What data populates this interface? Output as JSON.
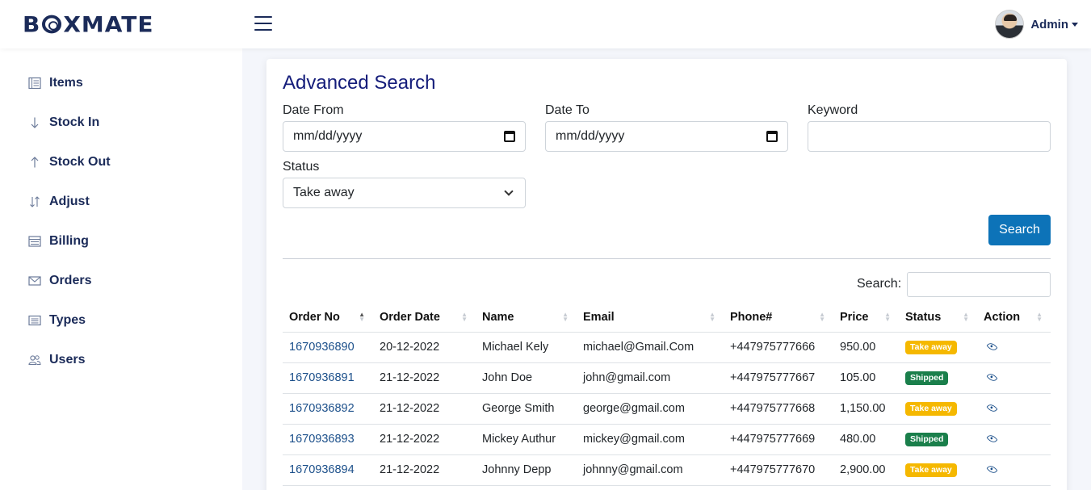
{
  "header": {
    "logo_text": "BOXMATE",
    "user_name": "Admin"
  },
  "sidebar": {
    "items": [
      {
        "label": "Items",
        "icon": "list-icon"
      },
      {
        "label": "Stock In",
        "icon": "arrow-down-icon"
      },
      {
        "label": "Stock Out",
        "icon": "arrow-up-icon"
      },
      {
        "label": "Adjust",
        "icon": "arrows-updown-icon"
      },
      {
        "label": "Billing",
        "icon": "billing-icon"
      },
      {
        "label": "Orders",
        "icon": "envelope-icon"
      },
      {
        "label": "Types",
        "icon": "list-alt-icon"
      },
      {
        "label": "Users",
        "icon": "users-icon"
      }
    ]
  },
  "search": {
    "title": "Advanced Search",
    "date_from_label": "Date From",
    "date_from_value": "mm/dd/yyyy",
    "date_to_label": "Date To",
    "date_to_value": "mm/dd/yyyy",
    "keyword_label": "Keyword",
    "keyword_value": "",
    "status_label": "Status",
    "status_value": "Take away",
    "button_label": "Search"
  },
  "table": {
    "search_label": "Search:",
    "columns": [
      "Order No",
      "Order Date",
      "Name",
      "Email",
      "Phone#",
      "Price",
      "Status",
      "Action"
    ],
    "rows": [
      {
        "order_no": "1670936890",
        "order_date": "20-12-2022",
        "name": "Michael Kely",
        "email": "michael@Gmail.Com",
        "phone": "+447975777666",
        "price": "950.00",
        "status": "Take away"
      },
      {
        "order_no": "1670936891",
        "order_date": "21-12-2022",
        "name": "John Doe",
        "email": "john@gmail.com",
        "phone": "+447975777667",
        "price": "105.00",
        "status": "Shipped"
      },
      {
        "order_no": "1670936892",
        "order_date": "21-12-2022",
        "name": "George Smith",
        "email": "george@gmail.com",
        "phone": "+447975777668",
        "price": "1,150.00",
        "status": "Take away"
      },
      {
        "order_no": "1670936893",
        "order_date": "21-12-2022",
        "name": "Mickey Authur",
        "email": "mickey@gmail.com",
        "phone": "+447975777669",
        "price": "480.00",
        "status": "Shipped"
      },
      {
        "order_no": "1670936894",
        "order_date": "21-12-2022",
        "name": "Johnny Depp",
        "email": "johnny@gmail.com",
        "phone": "+447975777670",
        "price": "2,900.00",
        "status": "Take away"
      }
    ]
  },
  "colors": {
    "brand": "#1b2b59",
    "title": "#141c7a",
    "button": "#0d73b8",
    "badge_take_away": "#f5b800",
    "badge_shipped": "#1a7f4b"
  }
}
